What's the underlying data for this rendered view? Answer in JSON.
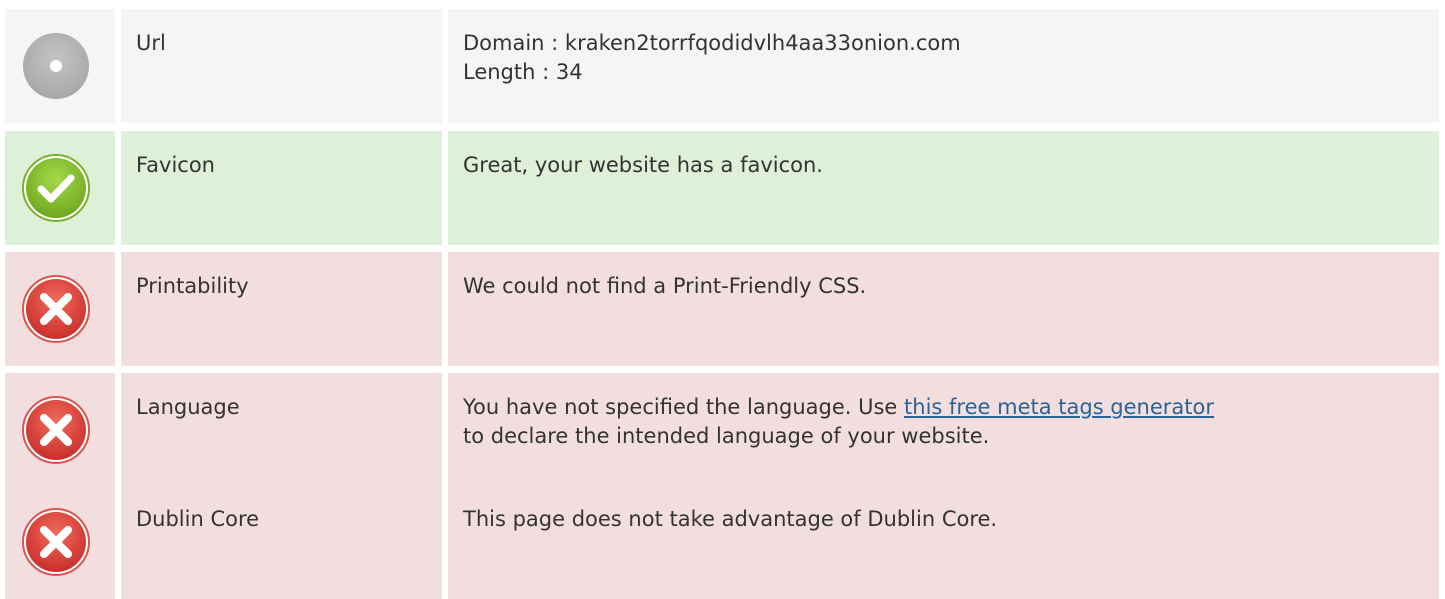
{
  "rows": [
    {
      "status": "neutral",
      "icon": "neutral-dot-icon",
      "label": "Url",
      "lines": [
        "Domain : kraken2torrfqodidvlh4aa33onion.com",
        "Length : 34"
      ]
    },
    {
      "status": "pass",
      "icon": "check-icon",
      "label": "Favicon",
      "text": "Great, your website has a favicon."
    },
    {
      "status": "fail",
      "icon": "error-x-icon",
      "label": "Printability",
      "text": "We could not find a Print-Friendly CSS."
    },
    {
      "status": "fail",
      "icon": "error-x-icon",
      "label": "Language",
      "text_before": "You have not specified the language. Use ",
      "link_text": "this free meta tags generator",
      "text_after": "to declare the intended language of your website."
    },
    {
      "status": "fail",
      "icon": "error-x-icon",
      "label": "Dublin Core",
      "text": "This page does not take advantage of Dublin Core."
    }
  ],
  "colors": {
    "neutral_bg": "#f5f5f5",
    "pass_bg": "#dff0d8",
    "fail_bg": "#f2dede",
    "link": "#2a6496",
    "text": "#333333"
  }
}
